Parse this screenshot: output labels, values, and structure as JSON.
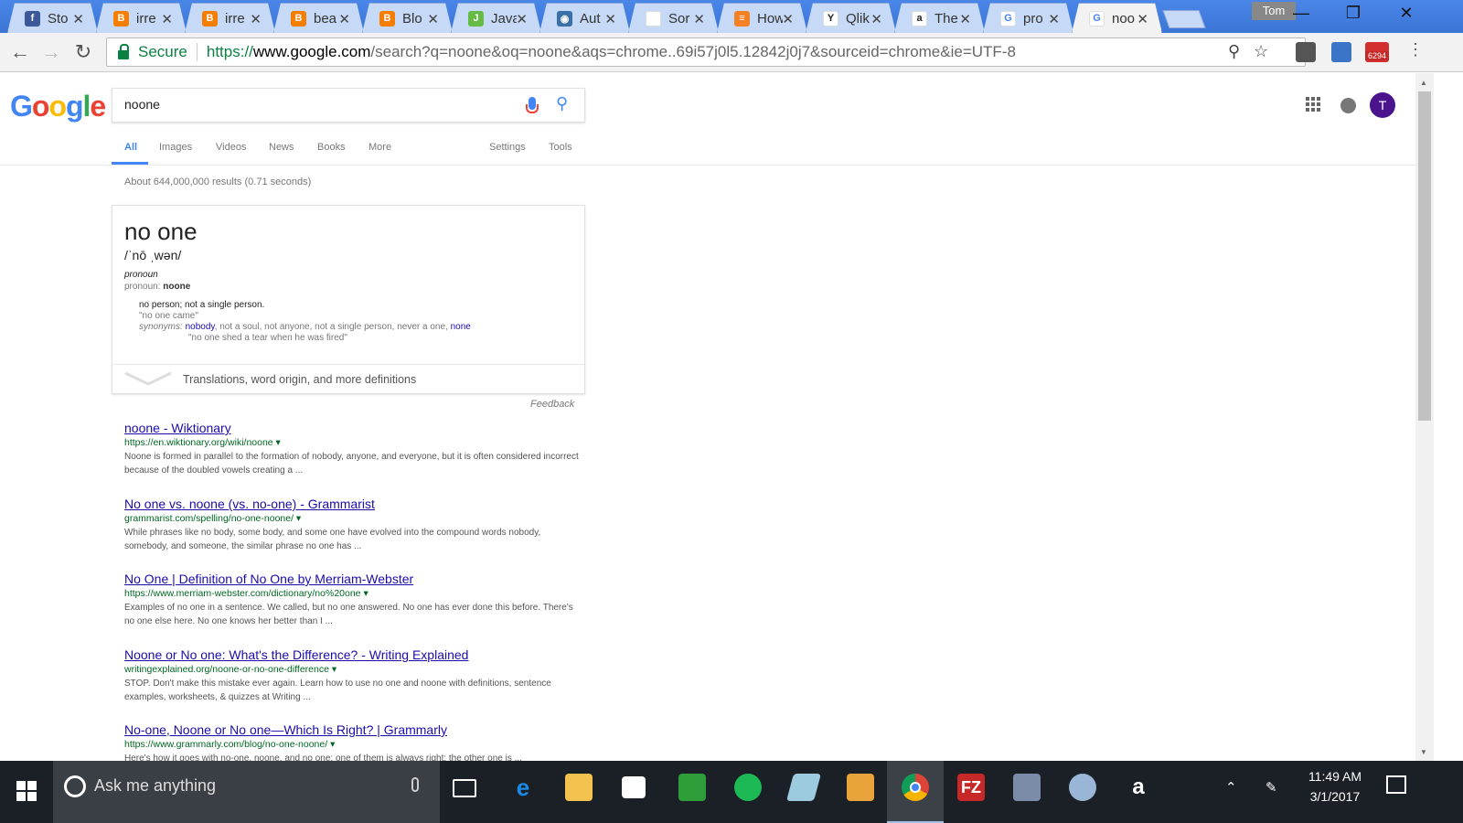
{
  "browser": {
    "tabs": [
      {
        "title": "Sto",
        "favicon": "facebook-icon",
        "color": "#3b5998",
        "glyph": "f"
      },
      {
        "title": "irre",
        "favicon": "blogger-icon",
        "color": "#f57d00",
        "glyph": "B"
      },
      {
        "title": "irre",
        "favicon": "blogger-icon",
        "color": "#f57d00",
        "glyph": "B"
      },
      {
        "title": "bea",
        "favicon": "blogger-icon",
        "color": "#f57d00",
        "glyph": "B"
      },
      {
        "title": "Blo",
        "favicon": "blogger-icon",
        "color": "#f57d00",
        "glyph": "B"
      },
      {
        "title": "Java",
        "favicon": "code-icon",
        "color": "#66bb44",
        "glyph": "J"
      },
      {
        "title": "Aut",
        "favicon": "eye-icon",
        "color": "#3a6fa8",
        "glyph": "◉"
      },
      {
        "title": "Sor",
        "favicon": "blank-page-icon",
        "color": "#ffffff",
        "glyph": ""
      },
      {
        "title": "How",
        "favicon": "stackoverflow-icon",
        "color": "#f48024",
        "glyph": "≡"
      },
      {
        "title": "Qlik",
        "favicon": "tree-icon",
        "color": "#ffffff",
        "glyph": "Y"
      },
      {
        "title": "The",
        "favicon": "amazon-icon",
        "color": "#ffffff",
        "glyph": "a"
      },
      {
        "title": "pro",
        "favicon": "google-icon",
        "color": "#ffffff",
        "glyph": "G"
      },
      {
        "title": "noo",
        "favicon": "google-icon",
        "color": "#ffffff",
        "glyph": "G",
        "active": true
      }
    ],
    "profile_name": "Tom",
    "close_glyph": "✕",
    "address": {
      "secure_label": "Secure",
      "scheme": "https://",
      "host": "www.google.com",
      "path": "/search?q=noone&oq=noone&aqs=chrome..69i57j0l5.12842j0j7&sourceid=chrome&ie=UTF-8"
    },
    "gmail_badge": "6294"
  },
  "search": {
    "logo": [
      "G",
      "o",
      "o",
      "g",
      "l",
      "e"
    ],
    "logo_colors": [
      "#4285f4",
      "#ea4335",
      "#fbbc05",
      "#4285f4",
      "#34a853",
      "#ea4335"
    ],
    "query": "noone",
    "nav": {
      "all": "All",
      "images": "Images",
      "videos": "Videos",
      "news": "News",
      "books": "Books",
      "more": "More",
      "settings": "Settings",
      "tools": "Tools"
    },
    "avatar_letter": "T",
    "stats": "About 644,000,000 results (0.71 seconds)",
    "dictionary": {
      "word": "no one",
      "pronunciation": "/ˈnō ˌwən/",
      "part_of_speech": "pronoun",
      "forms_label": "pronoun:",
      "forms_value": "noone",
      "definition": "no person; not a single person.",
      "example": "\"no one came\"",
      "synonyms_label": "synonyms:",
      "syn_link1": "nobody",
      "syn_middle": ", not a soul, not anyone, not a single person, never a one, ",
      "syn_link2": "none",
      "example2": "\"no one shed a tear when he was fired\"",
      "more_label": "Translations, word origin, and more definitions"
    },
    "feedback": "Feedback",
    "results": [
      {
        "title": "noone - Wiktionary",
        "url": "https://en.wiktionary.org/wiki/noone",
        "snippet": "Noone is formed in parallel to the formation of nobody, anyone, and everyone, but it is often considered incorrect because of the doubled vowels creating a ..."
      },
      {
        "title": "No one vs. noone (vs. no-one) - Grammarist",
        "url": "grammarist.com/spelling/no-one-noone/",
        "snippet": "While phrases like no body, some body, and some one have evolved into the compound words nobody, somebody, and someone, the similar phrase no one has ..."
      },
      {
        "title": "No One | Definition of No One by Merriam-Webster",
        "url": "https://www.merriam-webster.com/dictionary/no%20one",
        "snippet": "Examples of no one in a sentence. We called, but no one answered. No one has ever done this before. There's no one else here. No one knows her better than I ..."
      },
      {
        "title": "Noone or No one: What's the Difference? - Writing Explained",
        "url": "writingexplained.org/noone-or-no-one-difference",
        "snippet": "STOP. Don't make this mistake ever again. Learn how to use no one and noone with definitions, sentence examples, worksheets, & quizzes at Writing ..."
      },
      {
        "title": "No-one, Noone or No one—Which Is Right? | Grammarly",
        "url": "https://www.grammarly.com/blog/no-one-noone/",
        "snippet": "Here's how it goes with no-one, noone, and no one: one of them is always right; the other one is ..."
      }
    ]
  },
  "taskbar": {
    "cortana_placeholder": "Ask me anything",
    "time": "11:49 AM",
    "date": "3/1/2017"
  }
}
